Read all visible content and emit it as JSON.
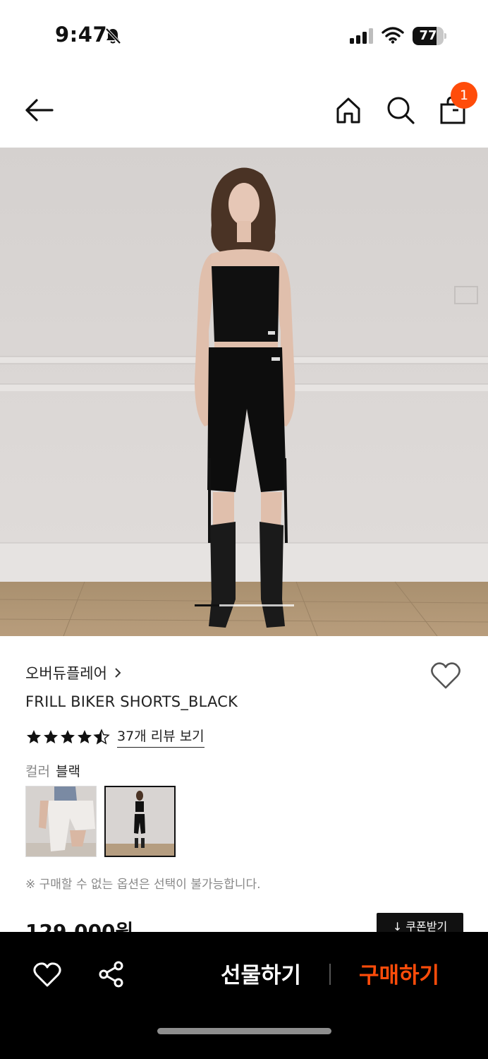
{
  "status_bar": {
    "time": "9:47",
    "battery": "77",
    "battery_level": 0.77,
    "icons": [
      "bell-off-icon",
      "signal-icon",
      "wifi-icon",
      "battery-icon"
    ]
  },
  "nav": {
    "icons": [
      "back-arrow-icon",
      "home-icon",
      "search-icon",
      "shopping-bag-icon"
    ],
    "cart_count": "1"
  },
  "gallery": {
    "current_index": 1,
    "indicator_fraction": 0.25
  },
  "product": {
    "brand": "오버듀플레어",
    "title": "FRILL BIKER SHORTS_BLACK",
    "rating": 4.5,
    "review_link": "37개 리뷰 보기",
    "color_label": "컬러",
    "color_value": "블랙",
    "option_notice": "※ 구매할 수 없는 옵션은 선택이 불가능합니다.",
    "price": "129,000원",
    "coupon_button": "↓ 쿠폰받기"
  },
  "bottom_bar": {
    "gift_label": "선물하기",
    "buy_label": "구매하기"
  },
  "colors": {
    "accent": "#ff4c0a",
    "background": "#ffffff",
    "bottom_bar": "#000000"
  }
}
